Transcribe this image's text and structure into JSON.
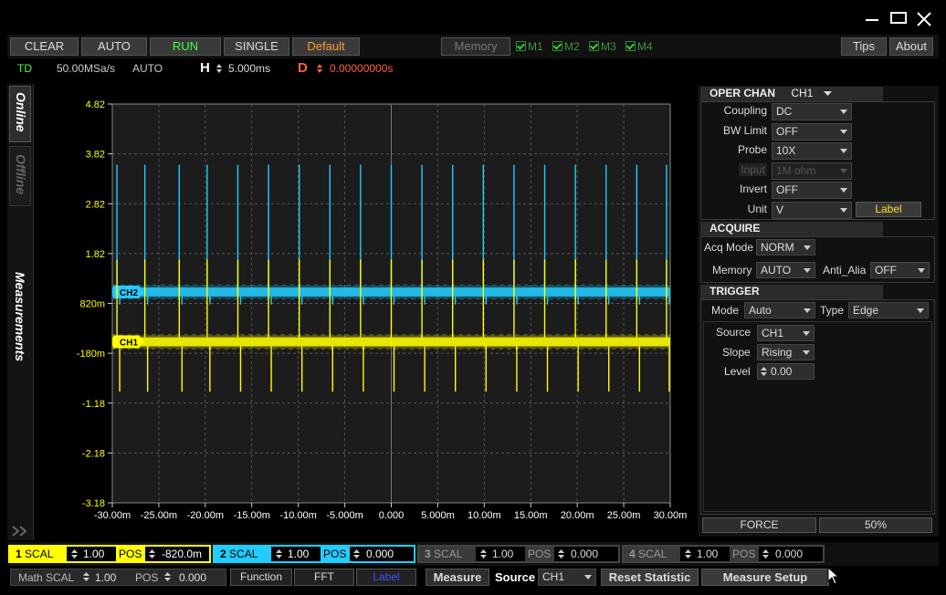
{
  "window": {
    "controls": [
      "minimize",
      "maximize",
      "close"
    ]
  },
  "toolbar": {
    "clear": "CLEAR",
    "auto": "AUTO",
    "run": "RUN",
    "single": "SINGLE",
    "default": "Default",
    "memory": "Memory",
    "m1": "M1",
    "m2": "M2",
    "m3": "M3",
    "m4": "M4",
    "tips": "Tips",
    "about": "About"
  },
  "status": {
    "mode": "TD",
    "sample_rate": "50.00MSa/s",
    "acq": "AUTO",
    "h_label": "H",
    "h_value": "5.000ms",
    "d_label": "D",
    "d_value": "0.00000000s"
  },
  "side_tabs": {
    "online": "Online",
    "offline": "Offline",
    "measurements": "Measurements"
  },
  "colors": {
    "ch1": "#ffff00",
    "ch2": "#22ccff",
    "accent": "#ff6633",
    "run": "#44ff44"
  },
  "chart_data": {
    "type": "line",
    "x": {
      "ticks": [
        "-30.00m",
        "-25.00m",
        "-20.00m",
        "-15.00m",
        "-10.00m",
        "-5.000m",
        "0.000",
        "5.000m",
        "10.00m",
        "15.00m",
        "20.00m",
        "25.00m",
        "30.00m"
      ],
      "range": [
        -30,
        30
      ],
      "unit": "ms"
    },
    "y": {
      "ticks": [
        "4.82",
        "3.82",
        "2.82",
        "1.82",
        "820m",
        "-180m",
        "-1.18",
        "-2.18",
        "-3.18"
      ],
      "range": [
        -3.18,
        4.82
      ]
    },
    "grid": true,
    "series": [
      {
        "name": "CH2",
        "color": "#22ccff",
        "baseline": 1.05,
        "band": 0.18,
        "spike_up": 3.6,
        "spike_down": 0.8
      },
      {
        "name": "CH1",
        "color": "#ffff00",
        "baseline": 0.05,
        "band": 0.18,
        "spike_up": 1.7,
        "spike_down": -0.95
      }
    ],
    "spike_times_ms": [
      -29.5,
      -26.5,
      -22.8,
      -19.8,
      -16.5,
      -13.2,
      -9.9,
      -6.6,
      -3.3,
      0.0,
      3.3,
      6.6,
      9.9,
      13.2,
      16.5,
      19.8,
      23.1,
      26.4,
      29.6
    ]
  },
  "oper_chan": {
    "title": "OPER CHAN",
    "channel": "CH1",
    "rows": [
      {
        "label": "Coupling",
        "value": "DC"
      },
      {
        "label": "BW Limit",
        "value": "OFF"
      },
      {
        "label": "Probe",
        "value": "10X"
      },
      {
        "label": "Input",
        "value": "1M ohm"
      },
      {
        "label": "Invert",
        "value": "OFF"
      },
      {
        "label": "Unit",
        "value": "V"
      }
    ],
    "label_btn": "Label"
  },
  "acquire": {
    "title": "ACQUIRE",
    "acq_mode_label": "Acq Mode",
    "acq_mode": "NORM",
    "memory_label": "Memory",
    "memory": "AUTO",
    "anti_label": "Anti_Alia",
    "anti": "OFF"
  },
  "trigger": {
    "title": "TRIGGER",
    "mode_label": "Mode",
    "mode": "Auto",
    "type_label": "Type",
    "type": "Edge",
    "source_label": "Source",
    "source": "CH1",
    "slope_label": "Slope",
    "slope": "Rising",
    "level_label": "Level",
    "level": "0.00",
    "force": "FORCE",
    "percent": "50%"
  },
  "channels": [
    {
      "num": "1",
      "scal_label": "SCAL",
      "scal": "1.00",
      "pos_label": "POS",
      "pos": "-820.0m"
    },
    {
      "num": "2",
      "scal_label": "SCAL",
      "scal": "1.00",
      "pos_label": "POS",
      "pos": "0.000"
    },
    {
      "num": "3",
      "scal_label": "SCAL",
      "scal": "1.00",
      "pos_label": "POS",
      "pos": "0.000"
    },
    {
      "num": "4",
      "scal_label": "SCAL",
      "scal": "1.00",
      "pos_label": "POS",
      "pos": "0.000"
    }
  ],
  "bottom": {
    "math_scal_label": "Math SCAL",
    "math_scal": "1.00",
    "math_pos_label": "POS",
    "math_pos": "0.000",
    "function": "Function",
    "fft": "FFT",
    "label": "Label",
    "measure": "Measure",
    "source_label": "Source",
    "source": "CH1",
    "reset": "Reset  Statistic",
    "measure_setup": "Measure Setup"
  }
}
